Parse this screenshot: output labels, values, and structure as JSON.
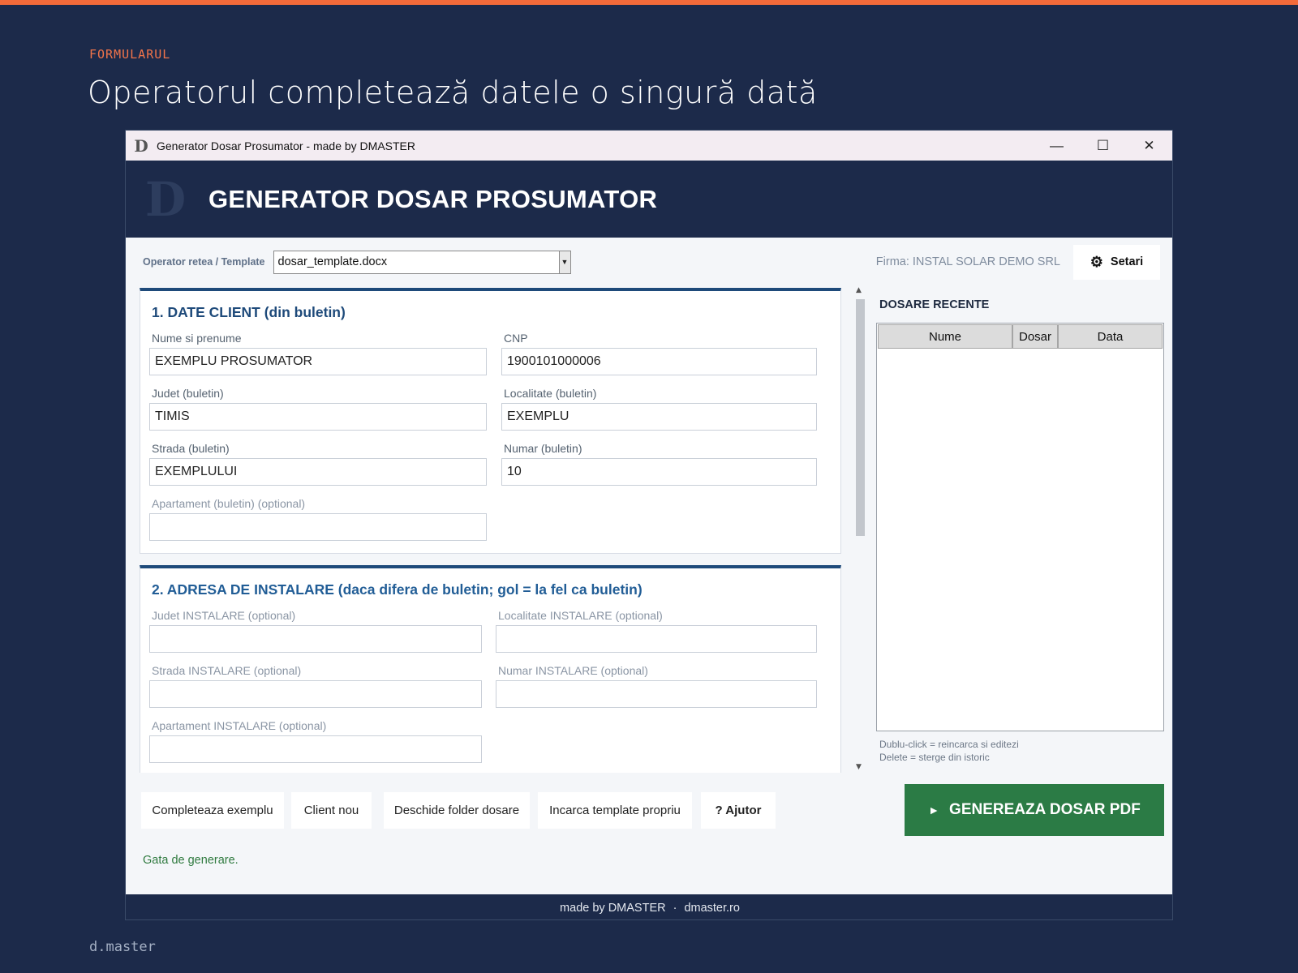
{
  "slide": {
    "eyebrow": "FORMULARUL",
    "headline": "Operatorul completează datele o singură dată",
    "brand": "d.master"
  },
  "window": {
    "icon_glyph": "D",
    "title": "Generator Dosar Prosumator - made by DMASTER",
    "controls": {
      "minimize": "—",
      "maximize": "☐",
      "close": "✕"
    }
  },
  "app": {
    "logo_glyph": "D",
    "title": "GENERATOR DOSAR PROSUMATOR"
  },
  "toolbar": {
    "template_label": "Operator retea / Template",
    "template_value": "dosar_template.docx",
    "firma": "Firma: INSTAL SOLAR DEMO SRL",
    "settings_label": "Setari"
  },
  "section1": {
    "title": "1. DATE CLIENT (din buletin)",
    "fields": {
      "nume": {
        "label": "Nume si prenume",
        "value": "EXEMPLU PROSUMATOR"
      },
      "cnp": {
        "label": "CNP",
        "value": "1900101000006"
      },
      "judet": {
        "label": "Judet (buletin)",
        "value": "TIMIS"
      },
      "localitate": {
        "label": "Localitate (buletin)",
        "value": "EXEMPLU"
      },
      "strada": {
        "label": "Strada (buletin)",
        "value": "EXEMPLULUI"
      },
      "numar": {
        "label": "Numar (buletin)",
        "value": "10"
      },
      "apartament": {
        "label": "Apartament (buletin)  (optional)",
        "value": ""
      }
    }
  },
  "section2": {
    "title": "2. ADRESA DE INSTALARE (daca difera de buletin; gol = la fel ca buletin)",
    "fields": {
      "judet": {
        "label": "Judet INSTALARE  (optional)",
        "value": ""
      },
      "localitate": {
        "label": "Localitate INSTALARE  (optional)",
        "value": ""
      },
      "strada": {
        "label": "Strada INSTALARE  (optional)",
        "value": ""
      },
      "numar": {
        "label": "Numar INSTALARE  (optional)",
        "value": ""
      },
      "apartament": {
        "label": "Apartament INSTALARE  (optional)",
        "value": ""
      }
    }
  },
  "recent": {
    "title": "DOSARE RECENTE",
    "columns": [
      "Nume",
      "Dosar",
      "Data"
    ],
    "rows": [],
    "hint1": "Dublu-click = reincarca si editezi",
    "hint2": "Delete = sterge din istoric"
  },
  "actions": {
    "fill_example": "Completeaza exemplu",
    "new_client": "Client nou",
    "open_folder": "Deschide folder dosare",
    "load_template": "Incarca template propriu",
    "help": "?  Ajutor",
    "generate": "GENEREAZA DOSAR PDF",
    "generate_icon": "►"
  },
  "status": "Gata de generare.",
  "footer": {
    "made_by": "made by DMASTER",
    "separator": "·",
    "site": "dmaster.ro"
  },
  "colors": {
    "background": "#1c2a4a",
    "accent": "#f26a3a",
    "section_title": "#1e4a7a",
    "generate_button": "#2b7b45",
    "status_ok": "#2f7a3f"
  }
}
